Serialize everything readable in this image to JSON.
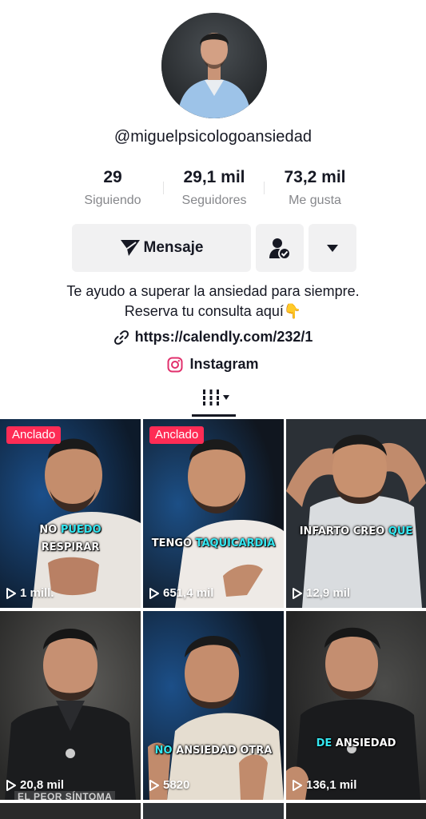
{
  "profile": {
    "username": "@miguelpsicologoansiedad",
    "stats": [
      {
        "value": "29",
        "label": "Siguiendo"
      },
      {
        "value": "29,1 mil",
        "label": "Seguidores"
      },
      {
        "value": "73,2 mil",
        "label": "Me gusta"
      }
    ],
    "message_button_label": "Mensaje",
    "bio_line1": "Te ayudo  a superar la ansiedad para siempre.",
    "bio_line2": "Reserva tu consulta aquí👇",
    "link_text": "https://calendly.com/232/1",
    "instagram_label": "Instagram"
  },
  "icons": {
    "message": "send-icon",
    "friend": "user-check-icon",
    "more": "caret-down-icon",
    "link": "link-icon",
    "instagram": "instagram-icon",
    "grid_tab": "grid-icon",
    "play": "play-icon"
  },
  "colors": {
    "pinned_badge": "#fe2c55",
    "caption_highlight": "#34e7f1",
    "text_primary": "#161823",
    "text_secondary": "#86878b"
  },
  "videos": [
    {
      "pinned": "Anclado",
      "views": "1 mill.",
      "caption_a": "NO",
      "caption_b": "PUEDO",
      "caption_c": "RESPIRAR"
    },
    {
      "pinned": "Anclado",
      "views": "651,4 mil",
      "caption_a": "TENGO",
      "caption_b": "TAQUICARDIA"
    },
    {
      "views": "12,9 mil",
      "caption_a": "INFARTO CREO",
      "caption_b": "QUE"
    },
    {
      "views": "20,8 mil",
      "bottom_text": "EL PEOR SÍNTOMA"
    },
    {
      "views": "5820",
      "caption_a": "NO",
      "caption_b": "ANSIEDAD OTRA"
    },
    {
      "views": "136,1 mil",
      "caption_a": "DE",
      "caption_b": "ANSIEDAD"
    }
  ]
}
